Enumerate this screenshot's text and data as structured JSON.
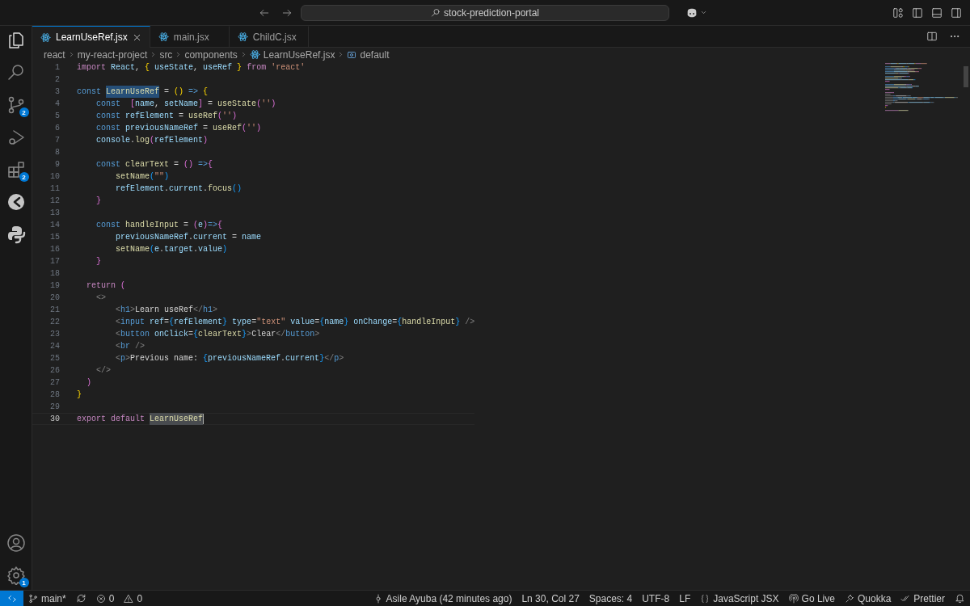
{
  "title_bar": {
    "search": "stock-prediction-portal"
  },
  "activity_bar": {
    "top": [
      {
        "kind": "explorer"
      },
      {
        "kind": "search"
      },
      {
        "kind": "scm",
        "badge": "2"
      },
      {
        "kind": "debug"
      },
      {
        "kind": "extensions",
        "badge": "2"
      },
      {
        "kind": "quokka"
      },
      {
        "kind": "python"
      }
    ],
    "bottom": [
      {
        "kind": "account"
      },
      {
        "kind": "settings",
        "badge": "1"
      }
    ]
  },
  "tabs": [
    {
      "label": "LearnUseRef.jsx",
      "selected": true
    },
    {
      "label": "main.jsx",
      "selected": false
    },
    {
      "label": "ChildC.jsx",
      "selected": false
    }
  ],
  "breadcrumb": [
    {
      "label": "react",
      "kind": "folder"
    },
    {
      "label": "my-react-project",
      "kind": "folder"
    },
    {
      "label": "src",
      "kind": "folder"
    },
    {
      "label": "components",
      "kind": "folder"
    },
    {
      "label": "LearnUseRef.jsx",
      "kind": "file"
    },
    {
      "label": "default",
      "kind": "symbol"
    }
  ],
  "lines": [
    {
      "number": "1",
      "current": false,
      "tokens": [
        {
          "text": "import",
          "kind": "ctl"
        },
        {
          "text": " React",
          "kind": "var"
        },
        {
          "text": ", ",
          "kind": "plain"
        },
        {
          "text": "{",
          "kind": "b1"
        },
        {
          "text": " useState",
          "kind": "var"
        },
        {
          "text": ", ",
          "kind": "plain"
        },
        {
          "text": "useRef ",
          "kind": "var"
        },
        {
          "text": "}",
          "kind": "b1"
        },
        {
          "text": " from ",
          "kind": "ctl"
        },
        {
          "text": "'react'",
          "kind": "str"
        }
      ]
    },
    {
      "number": "2",
      "current": false
    },
    {
      "number": "3",
      "current": false,
      "tokens": [
        {
          "text": "const ",
          "kind": "kw"
        },
        {
          "text": "LearnUseRef",
          "kind": "match"
        },
        {
          "text": " = ",
          "kind": "plain"
        },
        {
          "text": "()",
          "kind": "b1"
        },
        {
          "text": " => ",
          "kind": "kw"
        },
        {
          "text": "{",
          "kind": "b1"
        }
      ]
    },
    {
      "number": "4",
      "current": false,
      "tokens": [
        {
          "text": "    const  ",
          "kind": "kw"
        },
        {
          "text": "[",
          "kind": "b2"
        },
        {
          "text": "name",
          "kind": "var"
        },
        {
          "text": ", ",
          "kind": "plain"
        },
        {
          "text": "setName",
          "kind": "var"
        },
        {
          "text": "]",
          "kind": "b2"
        },
        {
          "text": " = ",
          "kind": "plain"
        },
        {
          "text": "useState",
          "kind": "fn"
        },
        {
          "text": "(",
          "kind": "b2"
        },
        {
          "text": "''",
          "kind": "str"
        },
        {
          "text": ")",
          "kind": "b2"
        }
      ]
    },
    {
      "number": "5",
      "current": false,
      "tokens": [
        {
          "text": "    const ",
          "kind": "kw"
        },
        {
          "text": "refElement",
          "kind": "var"
        },
        {
          "text": " = ",
          "kind": "plain"
        },
        {
          "text": "useRef",
          "kind": "fn"
        },
        {
          "text": "(",
          "kind": "b2"
        },
        {
          "text": "''",
          "kind": "str"
        },
        {
          "text": ")",
          "kind": "b2"
        }
      ]
    },
    {
      "number": "6",
      "current": false,
      "tokens": [
        {
          "text": "    const ",
          "kind": "kw"
        },
        {
          "text": "previousNameRef",
          "kind": "var"
        },
        {
          "text": " = ",
          "kind": "plain"
        },
        {
          "text": "useRef",
          "kind": "fn"
        },
        {
          "text": "(",
          "kind": "b2"
        },
        {
          "text": "''",
          "kind": "str"
        },
        {
          "text": ")",
          "kind": "b2"
        }
      ]
    },
    {
      "number": "7",
      "current": false,
      "tokens": [
        {
          "text": "    console",
          "kind": "var"
        },
        {
          "text": ".",
          "kind": "plain"
        },
        {
          "text": "log",
          "kind": "fn"
        },
        {
          "text": "(",
          "kind": "b2"
        },
        {
          "text": "refElement",
          "kind": "var"
        },
        {
          "text": ")",
          "kind": "b2"
        }
      ]
    },
    {
      "number": "8",
      "current": false
    },
    {
      "number": "9",
      "current": false,
      "tokens": [
        {
          "text": "    const ",
          "kind": "kw"
        },
        {
          "text": "clearText",
          "kind": "fn"
        },
        {
          "text": " = ",
          "kind": "plain"
        },
        {
          "text": "()",
          "kind": "b2"
        },
        {
          "text": " =>",
          "kind": "kw"
        },
        {
          "text": "{",
          "kind": "b2"
        }
      ]
    },
    {
      "number": "10",
      "current": false,
      "tokens": [
        {
          "text": "        setName",
          "kind": "fn"
        },
        {
          "text": "(",
          "kind": "b3"
        },
        {
          "text": "\"\"",
          "kind": "str"
        },
        {
          "text": ")",
          "kind": "b3"
        }
      ]
    },
    {
      "number": "11",
      "current": false,
      "tokens": [
        {
          "text": "        refElement",
          "kind": "var"
        },
        {
          "text": ".",
          "kind": "plain"
        },
        {
          "text": "current",
          "kind": "var"
        },
        {
          "text": ".",
          "kind": "plain"
        },
        {
          "text": "focus",
          "kind": "fn"
        },
        {
          "text": "()",
          "kind": "b3"
        }
      ]
    },
    {
      "number": "12",
      "current": false,
      "tokens": [
        {
          "text": "    }",
          "kind": "b2"
        }
      ]
    },
    {
      "number": "13",
      "current": false
    },
    {
      "number": "14",
      "current": false,
      "tokens": [
        {
          "text": "    const ",
          "kind": "kw"
        },
        {
          "text": "handleInput",
          "kind": "fn"
        },
        {
          "text": " = ",
          "kind": "plain"
        },
        {
          "text": "(",
          "kind": "b2"
        },
        {
          "text": "e",
          "kind": "var"
        },
        {
          "text": ")",
          "kind": "b2"
        },
        {
          "text": "=>",
          "kind": "kw"
        },
        {
          "text": "{",
          "kind": "b2"
        }
      ]
    },
    {
      "number": "15",
      "current": false,
      "tokens": [
        {
          "text": "        previousNameRef",
          "kind": "var"
        },
        {
          "text": ".",
          "kind": "plain"
        },
        {
          "text": "current",
          "kind": "var"
        },
        {
          "text": " = ",
          "kind": "plain"
        },
        {
          "text": "name",
          "kind": "var"
        }
      ]
    },
    {
      "number": "16",
      "current": false,
      "tokens": [
        {
          "text": "        setName",
          "kind": "fn"
        },
        {
          "text": "(",
          "kind": "b3"
        },
        {
          "text": "e",
          "kind": "var"
        },
        {
          "text": ".",
          "kind": "plain"
        },
        {
          "text": "target",
          "kind": "var"
        },
        {
          "text": ".",
          "kind": "plain"
        },
        {
          "text": "value",
          "kind": "var"
        },
        {
          "text": ")",
          "kind": "b3"
        }
      ]
    },
    {
      "number": "17",
      "current": false,
      "tokens": [
        {
          "text": "    }",
          "kind": "b2"
        }
      ]
    },
    {
      "number": "18",
      "current": false
    },
    {
      "number": "19",
      "current": false,
      "tokens": [
        {
          "text": "  return ",
          "kind": "ctl"
        },
        {
          "text": "(",
          "kind": "b2"
        }
      ]
    },
    {
      "number": "20",
      "current": false,
      "tokens": [
        {
          "text": "    <>",
          "kind": "tag"
        }
      ]
    },
    {
      "number": "21",
      "current": false,
      "tokens": [
        {
          "text": "        <",
          "kind": "tag"
        },
        {
          "text": "h1",
          "kind": "tagname"
        },
        {
          "text": ">",
          "kind": "tag"
        },
        {
          "text": "Learn useRef",
          "kind": "plain"
        },
        {
          "text": "</",
          "kind": "tag"
        },
        {
          "text": "h1",
          "kind": "tagname"
        },
        {
          "text": ">",
          "kind": "tag"
        }
      ]
    },
    {
      "number": "22",
      "current": false,
      "tokens": [
        {
          "text": "        <",
          "kind": "tag"
        },
        {
          "text": "input",
          "kind": "tagname"
        },
        {
          "text": " ref",
          "kind": "attr"
        },
        {
          "text": "=",
          "kind": "plain"
        },
        {
          "text": "{",
          "kind": "b3"
        },
        {
          "text": "refElement",
          "kind": "var"
        },
        {
          "text": "}",
          "kind": "b3"
        },
        {
          "text": " type",
          "kind": "attr"
        },
        {
          "text": "=",
          "kind": "plain"
        },
        {
          "text": "\"text\"",
          "kind": "str"
        },
        {
          "text": " value",
          "kind": "attr"
        },
        {
          "text": "=",
          "kind": "plain"
        },
        {
          "text": "{",
          "kind": "b3"
        },
        {
          "text": "name",
          "kind": "var"
        },
        {
          "text": "}",
          "kind": "b3"
        },
        {
          "text": " onChange",
          "kind": "attr"
        },
        {
          "text": "=",
          "kind": "plain"
        },
        {
          "text": "{",
          "kind": "b3"
        },
        {
          "text": "handleInput",
          "kind": "fn"
        },
        {
          "text": "}",
          "kind": "b3"
        },
        {
          "text": " />",
          "kind": "tag"
        }
      ]
    },
    {
      "number": "23",
      "current": false,
      "tokens": [
        {
          "text": "        <",
          "kind": "tag"
        },
        {
          "text": "button",
          "kind": "tagname"
        },
        {
          "text": " onClick",
          "kind": "attr"
        },
        {
          "text": "=",
          "kind": "plain"
        },
        {
          "text": "{",
          "kind": "b3"
        },
        {
          "text": "clearText",
          "kind": "fn"
        },
        {
          "text": "}",
          "kind": "b3"
        },
        {
          "text": ">",
          "kind": "tag"
        },
        {
          "text": "Clear",
          "kind": "plain"
        },
        {
          "text": "</",
          "kind": "tag"
        },
        {
          "text": "button",
          "kind": "tagname"
        },
        {
          "text": ">",
          "kind": "tag"
        }
      ]
    },
    {
      "number": "24",
      "current": false,
      "tokens": [
        {
          "text": "        <",
          "kind": "tag"
        },
        {
          "text": "br",
          "kind": "tagname"
        },
        {
          "text": " />",
          "kind": "tag"
        }
      ]
    },
    {
      "number": "25",
      "current": false,
      "tokens": [
        {
          "text": "        <",
          "kind": "tag"
        },
        {
          "text": "p",
          "kind": "tagname"
        },
        {
          "text": ">",
          "kind": "tag"
        },
        {
          "text": "Previous name: ",
          "kind": "plain"
        },
        {
          "text": "{",
          "kind": "b3"
        },
        {
          "text": "previousNameRef",
          "kind": "var"
        },
        {
          "text": ".",
          "kind": "plain"
        },
        {
          "text": "current",
          "kind": "var"
        },
        {
          "text": "}",
          "kind": "b3"
        },
        {
          "text": "</",
          "kind": "tag"
        },
        {
          "text": "p",
          "kind": "tagname"
        },
        {
          "text": ">",
          "kind": "tag"
        }
      ]
    },
    {
      "number": "26",
      "current": false,
      "tokens": [
        {
          "text": "    </>",
          "kind": "tag"
        }
      ]
    },
    {
      "number": "27",
      "current": false,
      "tokens": [
        {
          "text": "  )",
          "kind": "b2"
        }
      ]
    },
    {
      "number": "28",
      "current": false,
      "tokens": [
        {
          "text": "}",
          "kind": "b1"
        }
      ]
    },
    {
      "number": "29",
      "current": false
    },
    {
      "number": "30",
      "current": true,
      "tokens": [
        {
          "text": "export default ",
          "kind": "ctl"
        },
        {
          "text": "LearnUseRef",
          "kind": "cursorword"
        }
      ]
    }
  ],
  "status_bar": {
    "left": [
      {
        "text": "main*",
        "kind": "branch"
      },
      {
        "kind": "sync"
      },
      {
        "text": "0",
        "kind": "errors"
      },
      {
        "text": "0",
        "kind": "warnings"
      }
    ],
    "right": [
      {
        "text": "Asile Ayuba (42 minutes ago)",
        "kind": "blame"
      },
      {
        "text": "Ln 30, Col 27",
        "kind": "plain"
      },
      {
        "text": "Spaces: 4",
        "kind": "plain"
      },
      {
        "text": "UTF-8",
        "kind": "plain"
      },
      {
        "text": "LF",
        "kind": "plain"
      },
      {
        "text": "JavaScript JSX",
        "kind": "language"
      },
      {
        "text": "Go Live",
        "kind": "live"
      },
      {
        "text": "Quokka",
        "kind": "quokka"
      },
      {
        "text": "Prettier",
        "kind": "prettier"
      },
      {
        "kind": "bell"
      }
    ]
  }
}
